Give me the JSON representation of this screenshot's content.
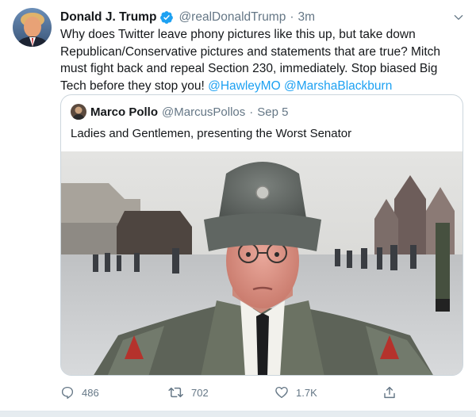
{
  "tweet": {
    "author_name": "Donald J. Trump",
    "handle": "@realDonaldTrump",
    "separator": "·",
    "time": "3m",
    "text_plain": "Why does Twitter leave phony pictures like this up, but take down Republican/Conservative pictures and statements that are true? Mitch must fight back and repeal Section 230, immediately. Stop biased Big Tech before they stop you! ",
    "mention_1": "@HawleyMO",
    "mention_2": "@MarshaBlackburn",
    "avatar_icon": "user-avatar",
    "verified_icon": "verified-badge-icon",
    "caret_icon": "chevron-down-icon"
  },
  "quoted": {
    "author_name": "Marco Pollo",
    "handle": "@MarcusPollos",
    "separator": "·",
    "date": "Sep 5",
    "text": "Ladies and Gentlemen, presenting the Worst Senator",
    "media_icon": "photo"
  },
  "actions": {
    "reply_count": "486",
    "retweet_count": "702",
    "like_count": "1.7K",
    "reply_icon": "reply-icon",
    "retweet_icon": "retweet-icon",
    "like_icon": "heart-icon",
    "share_icon": "share-icon"
  },
  "colors": {
    "link": "#1da1f2",
    "secondary_text": "#657786",
    "primary_text": "#14171a",
    "border": "#ccd6dd"
  }
}
